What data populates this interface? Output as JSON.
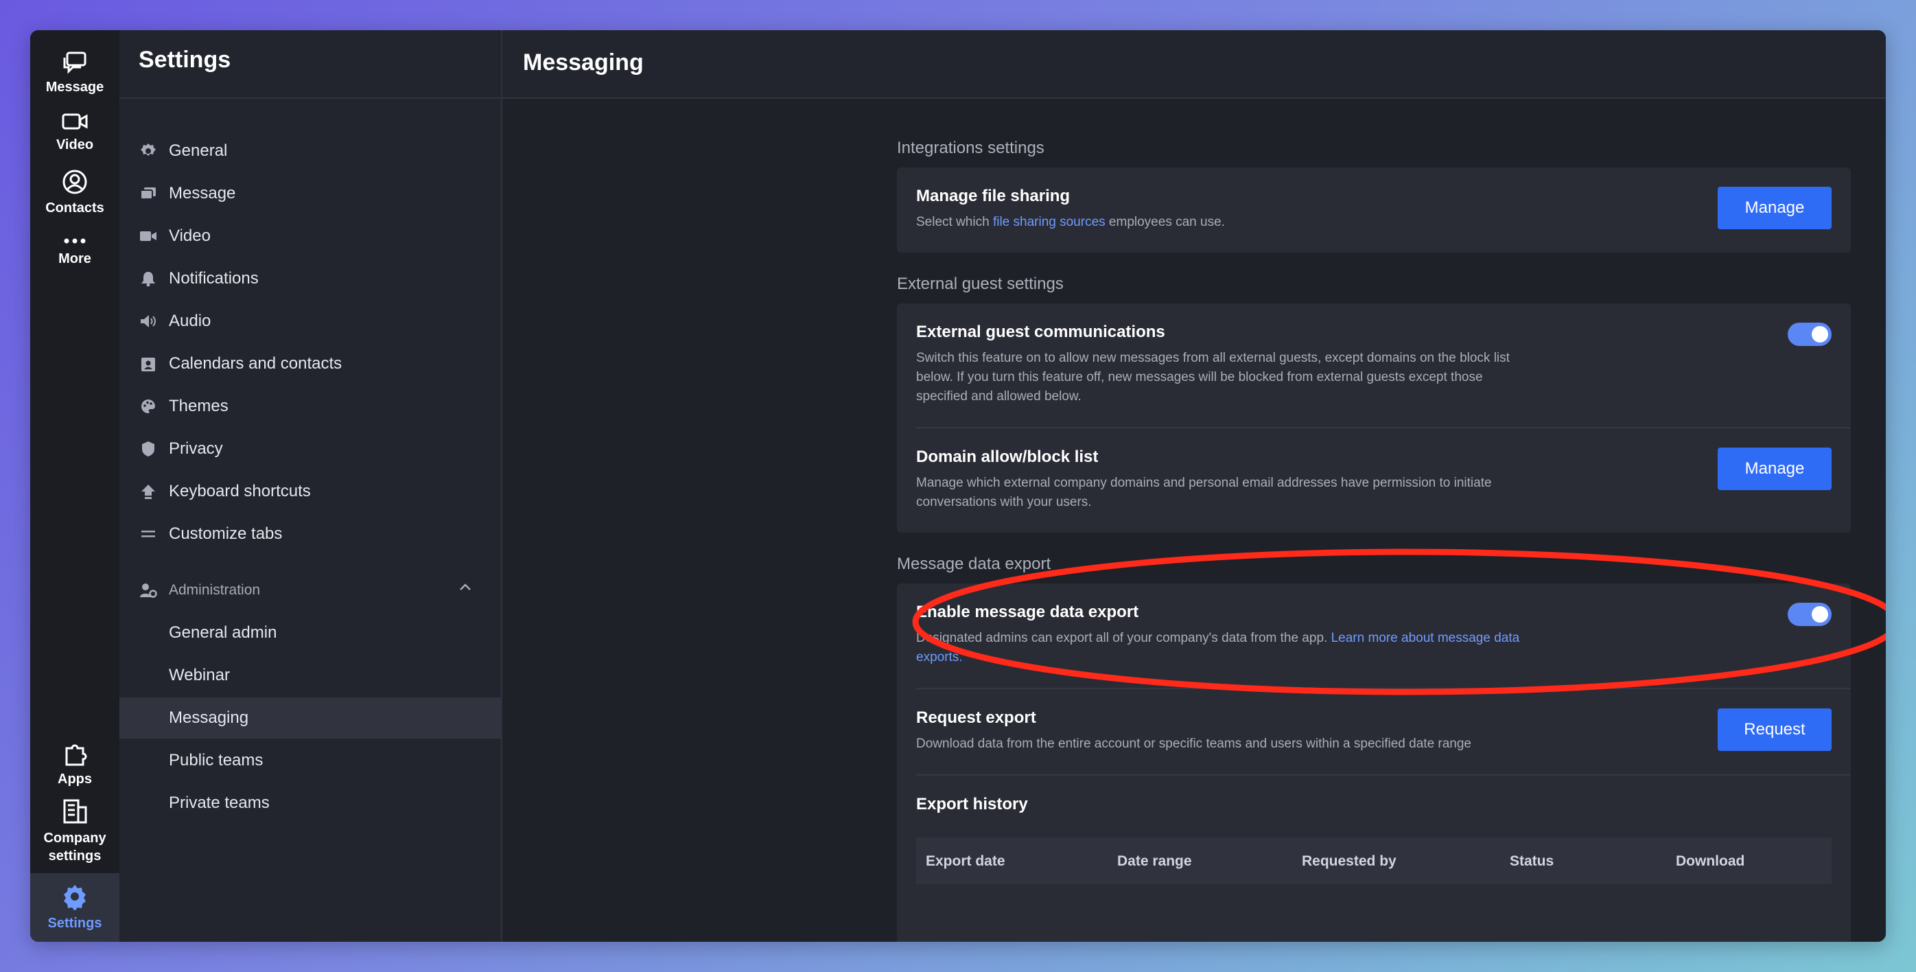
{
  "rail": {
    "items": [
      {
        "label": "Message",
        "icon": "message-icon"
      },
      {
        "label": "Video",
        "icon": "video-icon"
      },
      {
        "label": "Contacts",
        "icon": "contacts-icon"
      },
      {
        "label": "More",
        "icon": "more-icon"
      }
    ],
    "bottom": [
      {
        "label": "Apps",
        "icon": "apps-icon"
      },
      {
        "label": "Company settings",
        "icon": "company-settings-icon"
      },
      {
        "label": "Settings",
        "icon": "settings-icon",
        "active": true
      }
    ]
  },
  "sidebar": {
    "title": "Settings",
    "items": [
      {
        "label": "General",
        "icon": "gear-icon"
      },
      {
        "label": "Message",
        "icon": "message-icon"
      },
      {
        "label": "Video",
        "icon": "video-icon"
      },
      {
        "label": "Notifications",
        "icon": "bell-icon"
      },
      {
        "label": "Audio",
        "icon": "speaker-icon"
      },
      {
        "label": "Calendars and contacts",
        "icon": "calendar-icon"
      },
      {
        "label": "Themes",
        "icon": "palette-icon"
      },
      {
        "label": "Privacy",
        "icon": "shield-icon"
      },
      {
        "label": "Keyboard shortcuts",
        "icon": "keyboard-icon"
      },
      {
        "label": "Customize tabs",
        "icon": "tabs-icon"
      }
    ],
    "admin": {
      "label": "Administration",
      "items": [
        {
          "label": "General admin"
        },
        {
          "label": "Webinar"
        },
        {
          "label": "Messaging",
          "selected": true
        },
        {
          "label": "Public teams"
        },
        {
          "label": "Private teams"
        }
      ]
    }
  },
  "main": {
    "title": "Messaging",
    "integrations": {
      "section_label": "Integrations settings",
      "file_sharing": {
        "title": "Manage file sharing",
        "desc_before": "Select which ",
        "desc_link": "file sharing sources",
        "desc_after": " employees can use.",
        "button": "Manage"
      }
    },
    "external": {
      "section_label": "External guest settings",
      "guest_comm": {
        "title": "External guest communications",
        "desc": "Switch this feature on to allow new messages from all external guests, except domains on the block list below. If you turn this feature off, new messages will be blocked from external guests except those specified and allowed below.",
        "toggle_on": true
      },
      "domain_list": {
        "title": "Domain allow/block list",
        "desc": "Manage which external company domains and personal email addresses have permission to initiate conversations with your users.",
        "button": "Manage"
      }
    },
    "export": {
      "section_label": "Message data export",
      "enable": {
        "title": "Enable message data export",
        "desc_before": "Designated admins can export all of your company's data from the app. ",
        "desc_link": "Learn more about message data exports.",
        "toggle_on": true
      },
      "request": {
        "title": "Request export",
        "desc": "Download data from the entire account or specific teams and users within a specified date range",
        "button": "Request"
      },
      "history": {
        "title": "Export history",
        "columns": [
          "Export date",
          "Date range",
          "Requested by",
          "Status",
          "Download"
        ]
      }
    }
  },
  "colors": {
    "accent": "#2f6cf6",
    "toggle": "#5b87f5",
    "annotation": "#ff2a1a",
    "link": "#6f9bff"
  }
}
